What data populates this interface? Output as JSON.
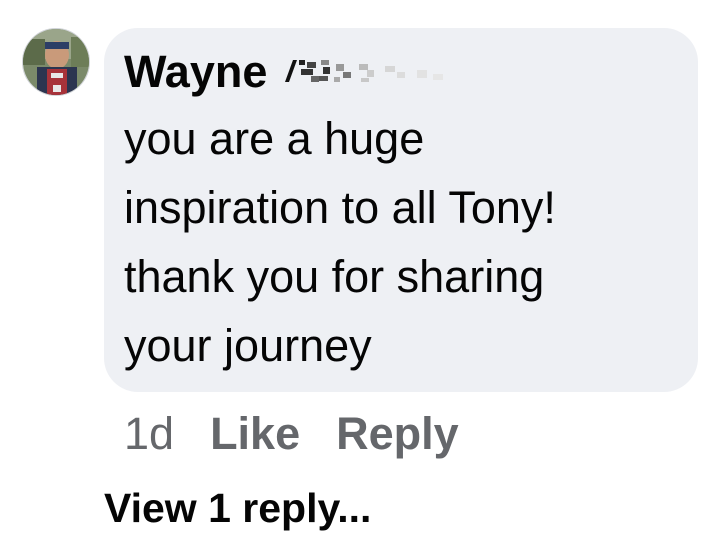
{
  "comment": {
    "author": "Wayne",
    "text": "you are a huge\ninspiration to all Tony!\nthank you for sharing\nyour journey",
    "timestamp": "1d",
    "like_label": "Like",
    "reply_label": "Reply"
  },
  "replies": {
    "view_label": "View 1 reply..."
  },
  "colors": {
    "bubble_bg": "#eef0f4",
    "text": "#050505",
    "secondary": "#65676b"
  },
  "icons": {
    "avatar": "profile-photo",
    "redacted_surname": "pixel-scramble"
  }
}
